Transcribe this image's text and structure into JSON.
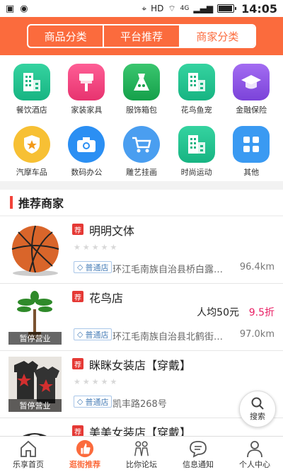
{
  "status_bar": {
    "carrier": "HD",
    "network": "4G",
    "time": "14:05"
  },
  "header": {
    "tabs": [
      {
        "label": "商品分类",
        "active": false
      },
      {
        "label": "平台推荐",
        "active": false
      },
      {
        "label": "商家分类",
        "active": true
      }
    ]
  },
  "categories": [
    {
      "label": "餐饮酒店",
      "icon": "building-icon"
    },
    {
      "label": "家装家具",
      "icon": "paint-brush-icon"
    },
    {
      "label": "服饰箱包",
      "icon": "dress-icon"
    },
    {
      "label": "花鸟鱼宠",
      "icon": "building-icon"
    },
    {
      "label": "金融保险",
      "icon": "graduation-cap-icon"
    },
    {
      "label": "汽摩车品",
      "icon": "shield-star-icon"
    },
    {
      "label": "数码办公",
      "icon": "camera-icon"
    },
    {
      "label": "雕艺挂画",
      "icon": "cart-icon"
    },
    {
      "label": "时尚运动",
      "icon": "building-icon"
    },
    {
      "label": "其他",
      "icon": "grid-icon"
    }
  ],
  "section": {
    "title": "推荐商家"
  },
  "shops": [
    {
      "tag": "荐",
      "name": "明明文体",
      "badge": "普通店",
      "address": "环江毛南族自治县桥白露…",
      "distance": "96.4km",
      "status": "",
      "avg_price": "",
      "discount": ""
    },
    {
      "tag": "荐",
      "name": "花鸟店",
      "badge": "普通店",
      "address": "环江毛南族自治县北鹤街1…",
      "distance": "97.0km",
      "status": "暂停营业",
      "avg_price": "人均50元",
      "discount": "9.5折"
    },
    {
      "tag": "荐",
      "name": "眯眯女装店【穿戴】",
      "badge": "普通店",
      "address": "凯丰路268号",
      "distance": "",
      "status": "暂停营业",
      "avg_price": "",
      "discount": ""
    },
    {
      "tag": "荐",
      "name": "美美女装店【穿戴】",
      "badge": "",
      "address": "",
      "distance": "",
      "status": "",
      "avg_price": "",
      "discount": ""
    }
  ],
  "fab": {
    "label": "搜索"
  },
  "tabbar": [
    {
      "label": "乐享首页",
      "icon": "home-icon",
      "active": false
    },
    {
      "label": "逛街推荐",
      "icon": "thumbs-up-icon",
      "active": true
    },
    {
      "label": "比你论坛",
      "icon": "people-icon",
      "active": false
    },
    {
      "label": "信息通知",
      "icon": "chat-icon",
      "active": false
    },
    {
      "label": "个人中心",
      "icon": "person-icon",
      "active": false
    }
  ],
  "colors": {
    "brand": "#fb6b3d",
    "recommend_tag": "#e53935",
    "discount": "#e91e63"
  }
}
